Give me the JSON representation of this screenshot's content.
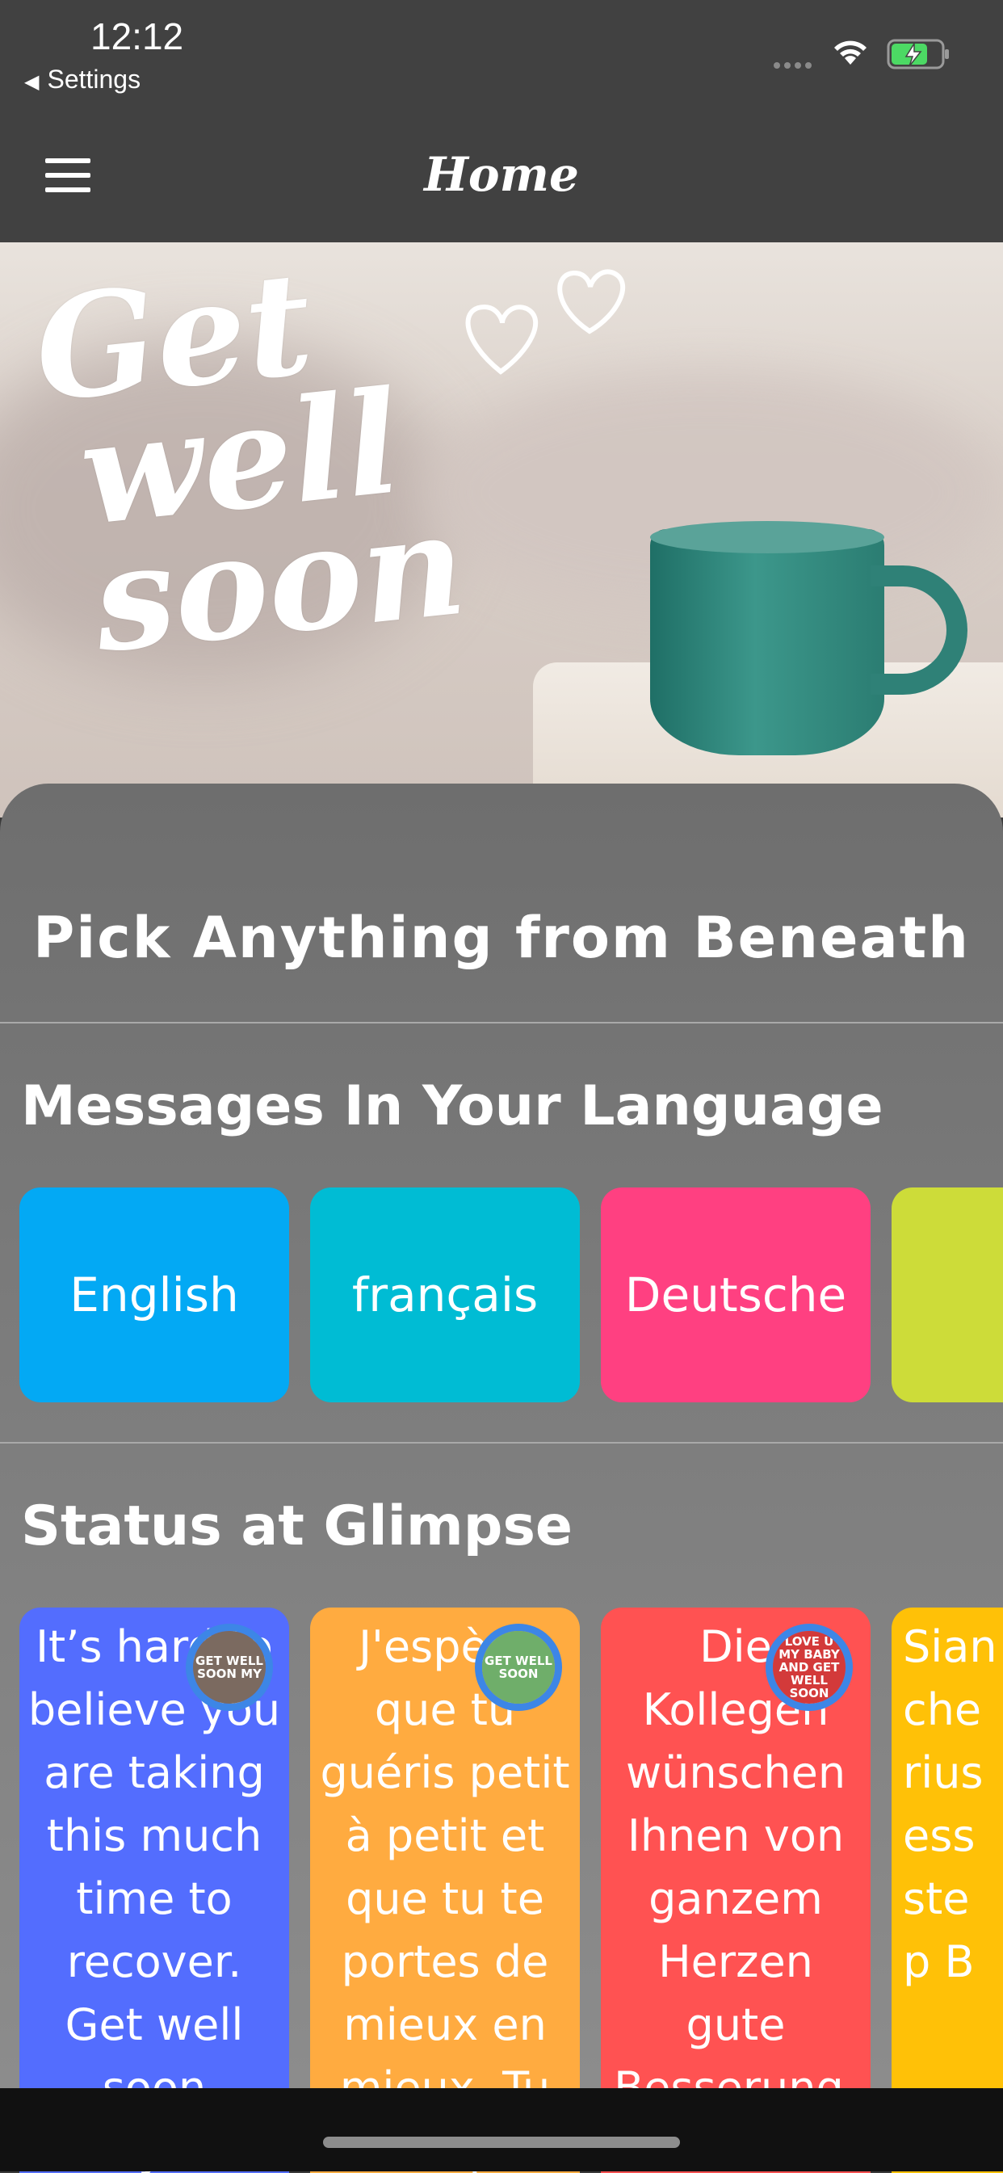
{
  "status_bar": {
    "time": "12:12",
    "back_label": "Settings"
  },
  "nav": {
    "title": "Home"
  },
  "hero": {
    "line1": "Get",
    "line2": "well",
    "line3": "soon"
  },
  "intro": {
    "heading": "Pick Anything from Beneath"
  },
  "languages_section": {
    "title": "Messages In Your Language",
    "items": [
      {
        "label": "English",
        "color": "#03A9F4"
      },
      {
        "label": "français",
        "color": "#00BCD4"
      },
      {
        "label": "Deutsche",
        "color": "#FF4081"
      },
      {
        "label": "",
        "color": "#CDDC39"
      }
    ]
  },
  "status_section": {
    "title": "Status at Glimpse",
    "cards": [
      {
        "text": "It’s hard to believe you are taking this much time to recover. Get well soon buddy. I am",
        "color": "#536DFE",
        "avatar_text": "GET WELL SOON MY",
        "avatar_bg": "#7b6a60"
      },
      {
        "text": "J'espère que tu guéris petit à petit et que tu te portes de mieux en mieux. Tu sais que",
        "color": "#FFAB40",
        "avatar_text": "GET WELL SOON",
        "avatar_bg": "#6fae6a"
      },
      {
        "text": "Die Kollegen wünschen Ihnen von ganzem Herzen gute Besserung. Wir alle",
        "color": "#FF5252",
        "avatar_text": "LOVE U MY BABY AND GET WELL SOON",
        "avatar_bg": "#d33a3a"
      },
      {
        "text": "Sian che rius ess ste p B",
        "color": "#FFC107",
        "avatar_text": "",
        "avatar_bg": ""
      }
    ]
  }
}
